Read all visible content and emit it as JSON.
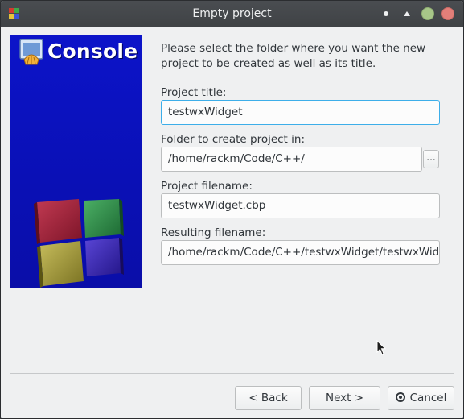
{
  "window": {
    "title": "Empty project",
    "app_icon": "codeblocks-icon"
  },
  "banner": {
    "title": "Console",
    "logo_icon": "console-shell-icon",
    "cube_colors": [
      "#a3223a",
      "#2f8f49",
      "#a49a3c",
      "#3a28b3"
    ]
  },
  "form": {
    "intro": "Please select the folder where you want the new project to be created as well as its title.",
    "project_title_label": "Project title:",
    "project_title_value": "testwxWidget",
    "folder_label": "Folder to create project in:",
    "folder_value": "/home/rackm/Code/C++/",
    "browse_label": "...",
    "filename_label": "Project filename:",
    "filename_value": "testwxWidget.cbp",
    "resulting_label": "Resulting filename:",
    "resulting_value": "/home/rackm/Code/C++/testwxWidget/testwxWidget.cbp"
  },
  "buttons": {
    "back": "< Back",
    "next": "Next >",
    "cancel": "Cancel"
  },
  "colors": {
    "focus_border": "#3daee9",
    "banner_blue": "#0c14c9",
    "maximize": "#a7c688",
    "close": "#e37f79"
  }
}
